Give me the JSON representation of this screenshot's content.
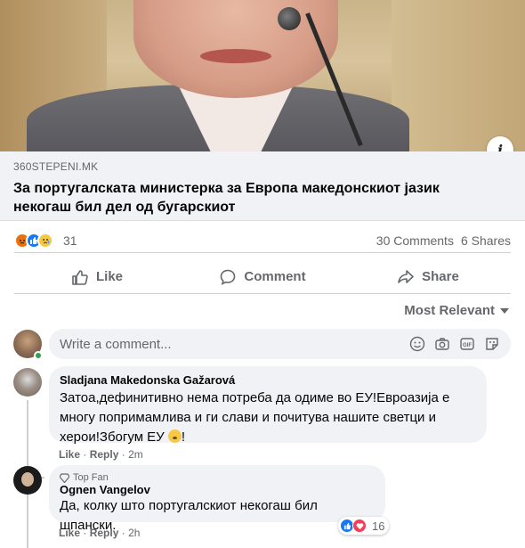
{
  "post": {
    "link_domain": "360STEPENI.MK",
    "link_title": "За португалската министерка за Европа македонскиот јазик некогаш бил дел од бугарскиот",
    "reaction_count": "31",
    "comments_count": "30 Comments",
    "shares_count": "6 Shares"
  },
  "actions": {
    "like": "Like",
    "comment": "Comment",
    "share": "Share"
  },
  "sort": {
    "label": "Most Relevant"
  },
  "composer": {
    "placeholder": "Write a comment..."
  },
  "comments": [
    {
      "author": "Sladjana Makedonska Gažarová",
      "text": "Затоа,дефинитивно нема потреба да одиме во ЕУ!Евроазија е многу попримамлива и ги слави и почитува нашите светци и херои!Збогум ЕУ",
      "text_end": "!",
      "like": "Like",
      "reply": "Reply",
      "time": "2m",
      "sep": "·"
    },
    {
      "badge": "Top Fan",
      "author": "Ognen Vangelov",
      "text": "Да, колку што португалскиот некогаш бил шпански.",
      "like": "Like",
      "reply": "Reply",
      "time": "2h",
      "sep": "·",
      "reaction_count": "16"
    }
  ],
  "colors": {
    "like_blue": "#1877f2",
    "love_red": "#f33e58",
    "angry_orange": "#e9710f",
    "muted": "#65676b"
  }
}
